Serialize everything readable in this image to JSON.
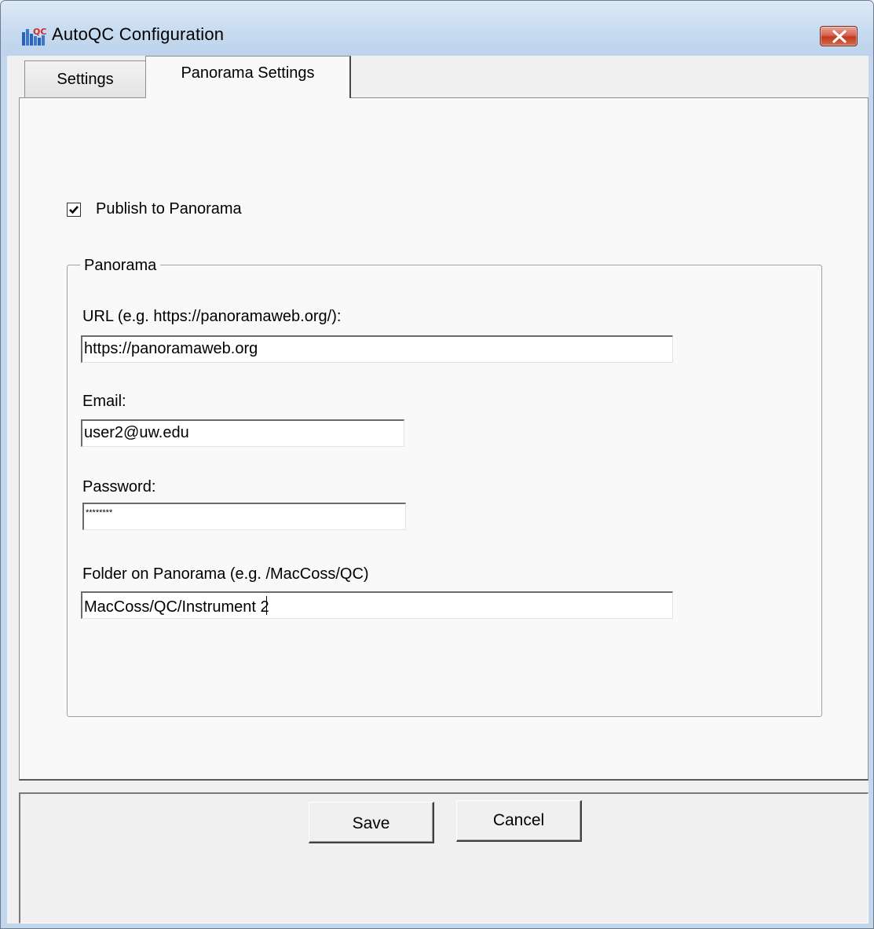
{
  "window": {
    "title": "AutoQC Configuration"
  },
  "tabs": [
    {
      "label": "Settings",
      "selected": false
    },
    {
      "label": "Panorama Settings",
      "selected": true
    }
  ],
  "publish_checkbox": {
    "label": "Publish to Panorama",
    "checked": true
  },
  "panorama_group": {
    "legend": "Panorama",
    "url": {
      "label": "URL (e.g. https://panoramaweb.org/):",
      "value": "https://panoramaweb.org"
    },
    "email": {
      "label": "Email:",
      "value": "user2@uw.edu"
    },
    "password": {
      "label": "Password:",
      "value": "********"
    },
    "folder": {
      "label": "Folder on Panorama (e.g. /MacCoss/QC)",
      "value": "MacCoss/QC/Instrument 2"
    }
  },
  "buttons": {
    "save": "Save",
    "cancel": "Cancel"
  },
  "icons": {
    "app": "autoqc-app-icon",
    "close": "close-icon",
    "check": "check-icon"
  },
  "colors": {
    "close_button": "#d0452f",
    "titlebar": "#c6daef",
    "panel": "#f9f9f9"
  }
}
